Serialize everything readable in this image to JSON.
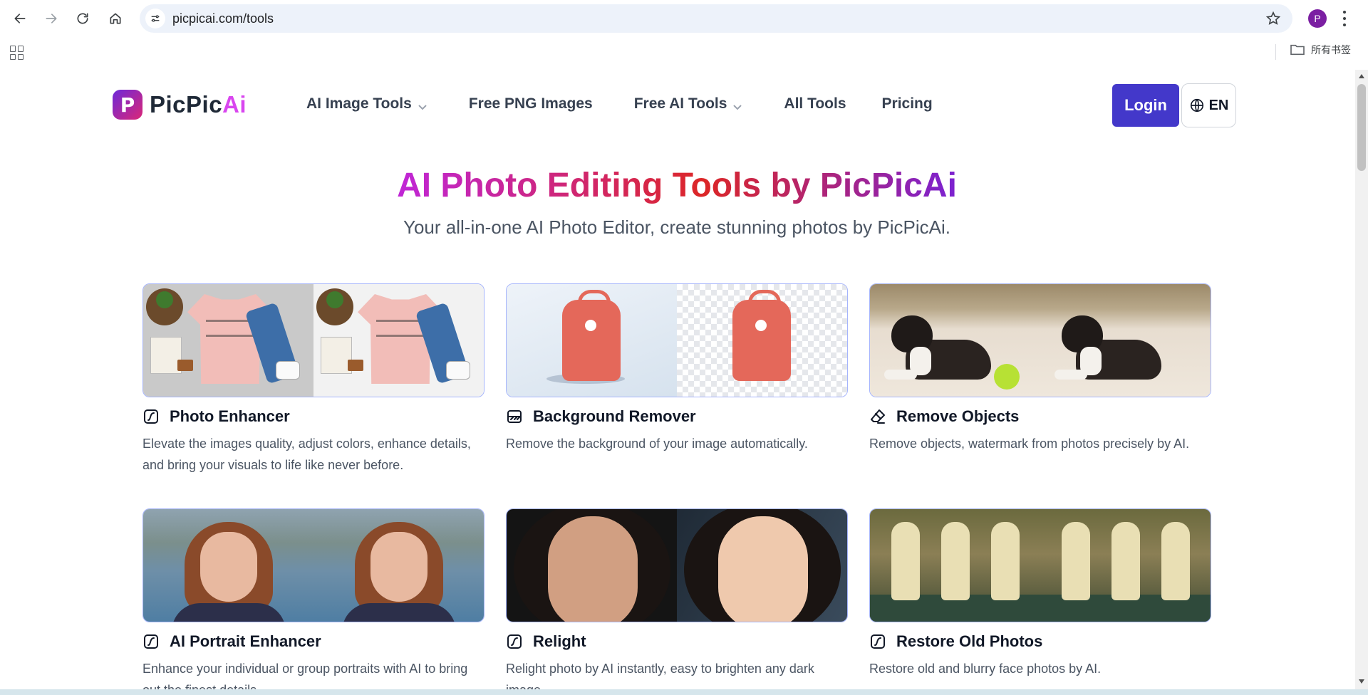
{
  "browser": {
    "url": "picpicai.com/tools",
    "profile_initial": "P",
    "bookmarks_folder": "所有书签"
  },
  "site": {
    "logo_text_main": "PicPic",
    "logo_text_accent": "Ai",
    "logo_mark_letter": "P",
    "nav": [
      {
        "label": "AI Image Tools",
        "dropdown": true
      },
      {
        "label": "Free PNG Images",
        "dropdown": false
      },
      {
        "label": "Free AI Tools",
        "dropdown": true
      },
      {
        "label": "All Tools",
        "dropdown": false
      },
      {
        "label": "Pricing",
        "dropdown": false
      }
    ],
    "login_label": "Login",
    "lang_label": "EN",
    "accent_color": "#4338ca"
  },
  "hero": {
    "title": "AI Photo Editing Tools by PicPicAi",
    "subtitle": "Your all-in-one AI Photo Editor, create stunning photos by PicPicAi."
  },
  "tools": [
    {
      "title": "Photo Enhancer",
      "icon": "enhance-icon",
      "desc": "Elevate the images quality, adjust colors, enhance details, and bring your visuals to life like never before."
    },
    {
      "title": "Background Remover",
      "icon": "background-icon",
      "desc": "Remove the background of your image automatically."
    },
    {
      "title": "Remove Objects",
      "icon": "eraser-icon",
      "desc": "Remove objects, watermark from photos precisely by AI."
    },
    {
      "title": "AI Portrait Enhancer",
      "icon": "enhance-icon",
      "desc": "Enhance your individual or group portraits with AI to bring out the finest details."
    },
    {
      "title": "Relight",
      "icon": "enhance-icon",
      "desc": "Relight photo by AI instantly, easy to brighten any dark image."
    },
    {
      "title": "Restore Old Photos",
      "icon": "enhance-icon",
      "desc": "Restore old and blurry face photos by AI."
    }
  ]
}
